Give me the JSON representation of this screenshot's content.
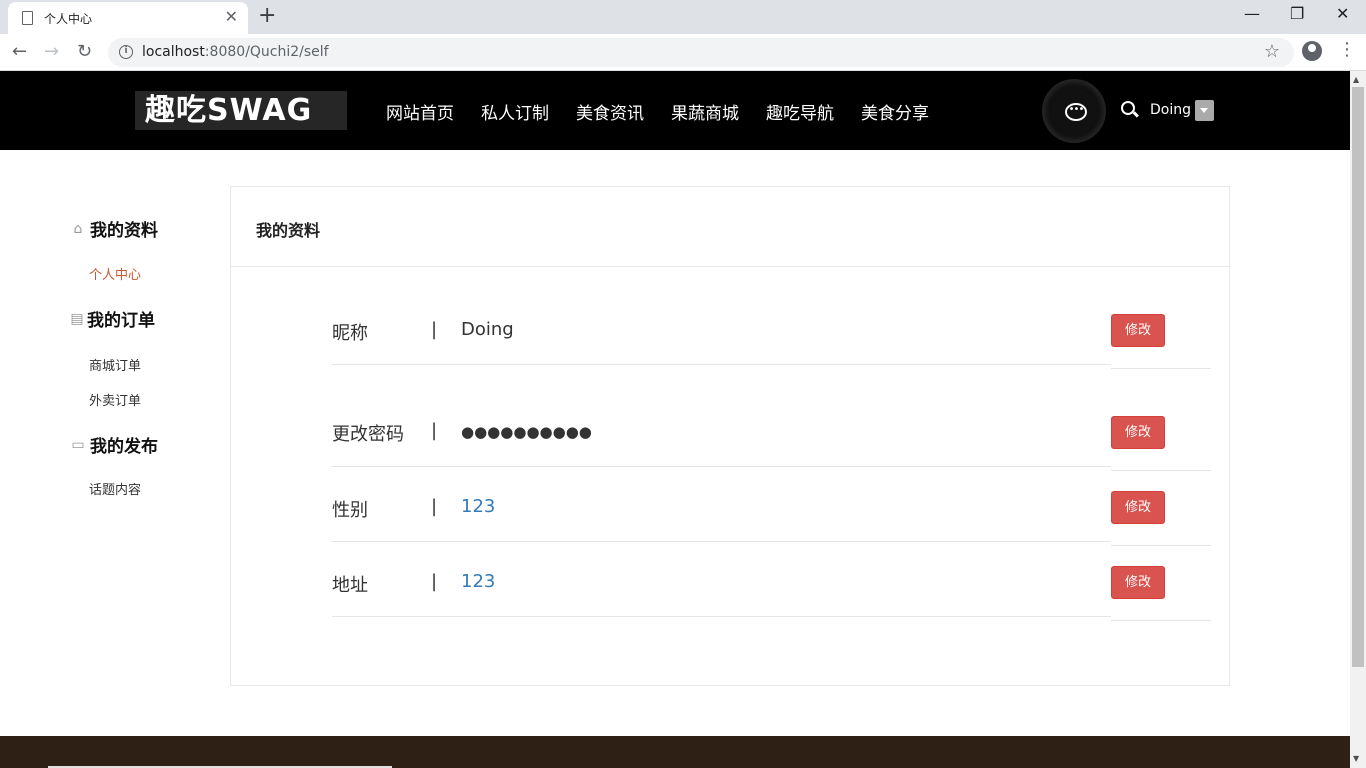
{
  "browser": {
    "tab_title": "个人中心",
    "url_host": "localhost",
    "url_rest": ":8080/Quchi2/self"
  },
  "site": {
    "logo_text": "趣吃SWAG",
    "nav": [
      "网站首页",
      "私人订制",
      "美食资讯",
      "果蔬商城",
      "趣吃导航",
      "美食分享"
    ],
    "username": "Doing"
  },
  "sidebar": {
    "groups": [
      {
        "title": "我的资料",
        "icon": "home-icon",
        "links": [
          "个人中心"
        ]
      },
      {
        "title": "我的订单",
        "icon": "document-icon",
        "links": [
          "商城订单",
          "外卖订单"
        ]
      },
      {
        "title": "我的发布",
        "icon": "comment-icon",
        "links": [
          "话题内容"
        ]
      }
    ],
    "active_link": "个人中心"
  },
  "panel": {
    "title": "我的资料",
    "separator": "|",
    "edit_label": "修改",
    "rows": [
      {
        "label": "昵称",
        "value": "Doing"
      },
      {
        "label": "更改密码",
        "value": "●●●●●●●●●●"
      },
      {
        "label": "性别",
        "value": "123"
      },
      {
        "label": "地址",
        "value": "123"
      }
    ]
  },
  "colors": {
    "header_bg": "#000000",
    "accent_active": "#c9582d",
    "edit_button": "#d9534f",
    "link_value": "#337ab7",
    "footer_bg": "#2e2015"
  }
}
